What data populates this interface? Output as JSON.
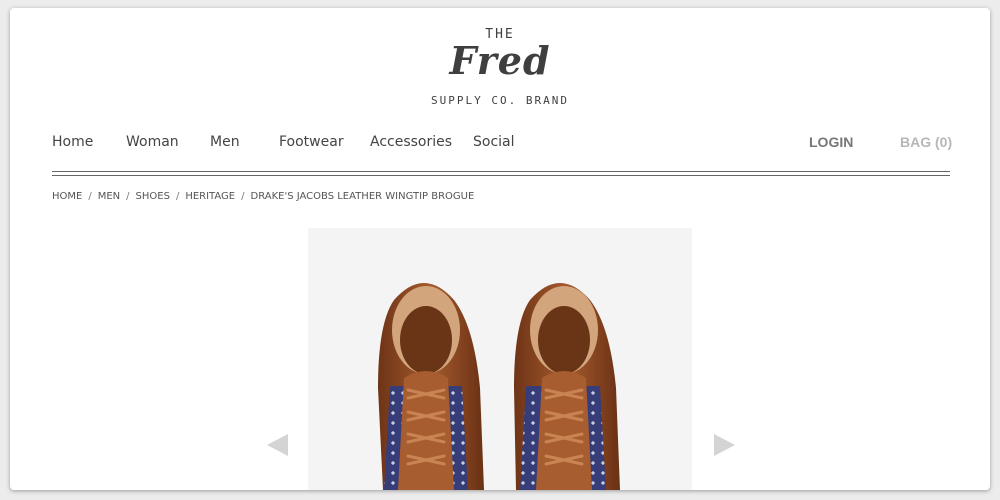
{
  "brand": {
    "top": "THE",
    "script": "Fred",
    "bottom": "SUPPLY CO. BRAND"
  },
  "nav": {
    "items": [
      {
        "label": "Home"
      },
      {
        "label": "Woman"
      },
      {
        "label": "Men"
      },
      {
        "label": "Footwear"
      },
      {
        "label": "Accessories"
      },
      {
        "label": "Social"
      }
    ],
    "login": "LOGIN",
    "bag": "BAG (0)"
  },
  "breadcrumb": {
    "items": [
      "HOME",
      "MEN",
      "SHOES",
      "HERITAGE",
      "DRAKE'S JACOBS LEATHER WINGTIP BROGUE"
    ],
    "separator": "/"
  },
  "product": {
    "image_icon": "leather-wingtip-brogue-shoes",
    "prev_icon": "arrow-left-icon",
    "next_icon": "arrow-right-icon"
  },
  "colors": {
    "leather": "#8e4a25",
    "navy": "#363d78",
    "image_bg": "#f4f4f4",
    "arrow": "#d4d4d4"
  }
}
